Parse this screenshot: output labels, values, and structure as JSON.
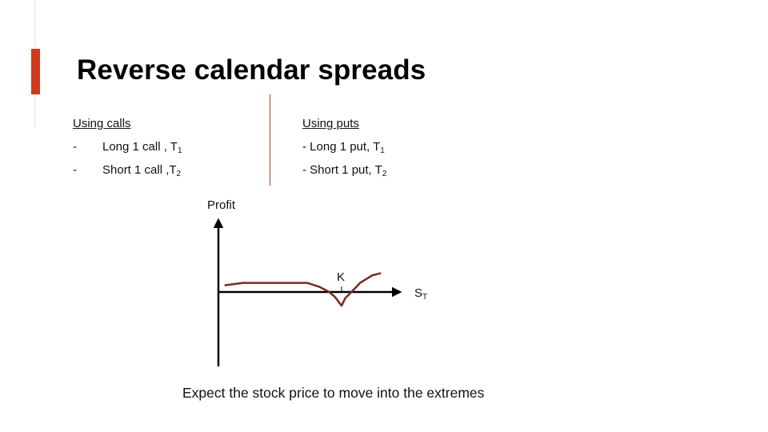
{
  "slide": {
    "title": "Reverse calendar spreads",
    "accent_color": "#cf3a1c",
    "caption": "Expect the stock price to move into the extremes"
  },
  "calls": {
    "heading": "Using calls",
    "items": [
      {
        "bullet": "-",
        "text": "Long 1 call , T",
        "sub": "1"
      },
      {
        "bullet": "-",
        "text": "Short 1 call ,T",
        "sub": "2"
      }
    ]
  },
  "puts": {
    "heading": "Using puts",
    "items": [
      {
        "text": "- Long 1 put, T",
        "sub": "1"
      },
      {
        "text": "- Short 1 put, T",
        "sub": "2"
      }
    ]
  },
  "chart_data": {
    "type": "line",
    "title": "",
    "xlabel": "S",
    "xlabel_sub": "T",
    "ylabel": "Profit",
    "strike_label": "K",
    "line_color": "#7b2a1e",
    "axis_color": "#000000",
    "grid": false,
    "note": "Qualitative payoff sketch, no numeric ticks; x in units where K = 1, profit in relative units (axis y=0)",
    "x": [
      0.05,
      0.2,
      0.45,
      0.72,
      0.82,
      0.9,
      0.95,
      1.0,
      1.03,
      1.08,
      1.15,
      1.25,
      1.32
    ],
    "y": [
      0.22,
      0.3,
      0.3,
      0.3,
      0.17,
      0.0,
      -0.18,
      -0.45,
      -0.2,
      0.0,
      0.3,
      0.55,
      0.62
    ],
    "xlim": [
      0,
      1.45
    ],
    "ylim": [
      -1.7,
      1.8
    ]
  }
}
